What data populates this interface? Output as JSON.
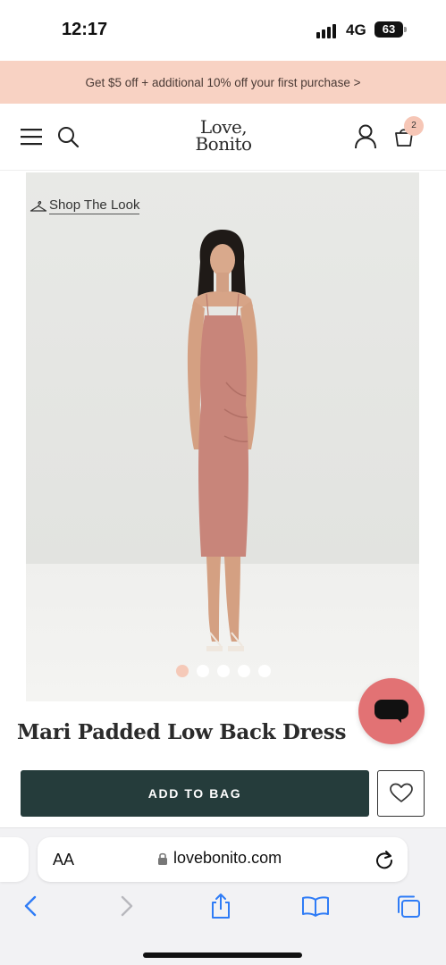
{
  "status": {
    "time": "12:17",
    "network": "4G",
    "battery": "63"
  },
  "promo": {
    "text": "Get $5 off + additional 10% off your first purchase >"
  },
  "header": {
    "logo_line1": "Love,",
    "logo_line2": "Bonito",
    "cart_count": "2",
    "icons": [
      "menu-icon",
      "search-icon",
      "account-icon",
      "cart-icon"
    ]
  },
  "product": {
    "shop_the_look": "Shop The Look",
    "title": "Mari Padded Low Back Dress",
    "image_count": 5,
    "active_image": 1,
    "add_to_bag": "ADD TO BAG"
  },
  "browser": {
    "aa": "AA",
    "url": "lovebonito.com",
    "toolbar": [
      "back-icon",
      "forward-icon",
      "share-icon",
      "bookmarks-icon",
      "tabs-icon"
    ]
  },
  "colors": {
    "promo_bg": "#f8d2c3",
    "button_bg": "#253c3b",
    "chat_bg": "#e27274",
    "dress": "#c8857a",
    "ios_blue": "#2f7cf6"
  }
}
